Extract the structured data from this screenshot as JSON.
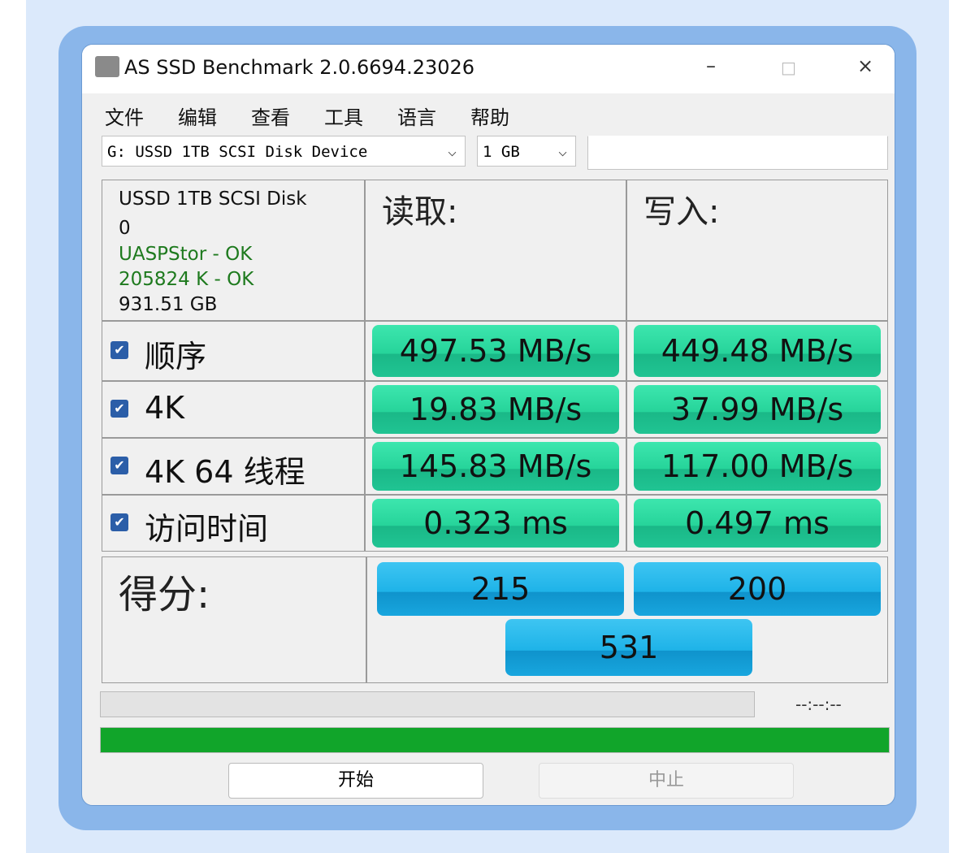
{
  "window": {
    "title": "AS SSD Benchmark 2.0.6694.23026",
    "minimize": "–",
    "maximize": "□",
    "close": "×"
  },
  "menu": [
    "文件",
    "编辑",
    "查看",
    "工具",
    "语言",
    "帮助"
  ],
  "drive_select": {
    "value": "G: USSD 1TB  SCSI Disk Device"
  },
  "size_select": {
    "value": "1 GB"
  },
  "device_info": {
    "name": "USSD 1TB  SCSI Disk",
    "line2": "0",
    "driver": "UASPStor - OK",
    "align": "205824 K - OK",
    "capacity": "931.51 GB"
  },
  "headers": {
    "read": "读取:",
    "write": "写入:",
    "score": "得分:"
  },
  "rows": [
    {
      "label": "顺序",
      "checked": true,
      "read": "497.53 MB/s",
      "write": "449.48 MB/s"
    },
    {
      "label": "4K",
      "checked": true,
      "read": "19.83 MB/s",
      "write": "37.99 MB/s"
    },
    {
      "label": "4K 64 线程",
      "checked": true,
      "read": "145.83 MB/s",
      "write": "117.00 MB/s"
    },
    {
      "label": "访问时间",
      "checked": true,
      "read": "0.323 ms",
      "write": "0.497 ms"
    }
  ],
  "scores": {
    "read": "215",
    "write": "200",
    "total": "531"
  },
  "progress": {
    "time": "--:--:--",
    "value": 0.0
  },
  "overall_progress": {
    "value": 1.0,
    "color": "#11a52a"
  },
  "buttons": {
    "start": "开始",
    "stop": "中止"
  }
}
